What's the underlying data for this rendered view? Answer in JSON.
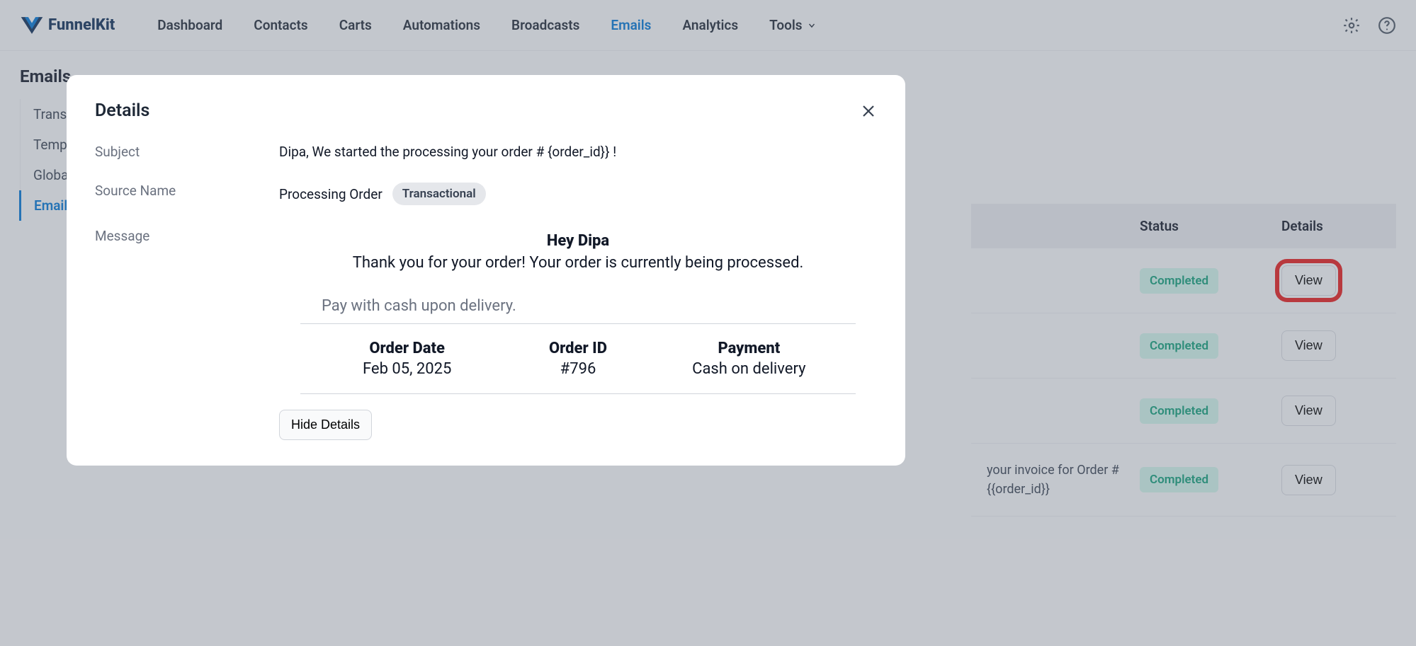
{
  "logo_text": "FunnelKit",
  "nav": {
    "items": [
      {
        "label": "Dashboard",
        "active": false
      },
      {
        "label": "Contacts",
        "active": false
      },
      {
        "label": "Carts",
        "active": false
      },
      {
        "label": "Automations",
        "active": false
      },
      {
        "label": "Broadcasts",
        "active": false
      },
      {
        "label": "Emails",
        "active": true
      },
      {
        "label": "Analytics",
        "active": false
      },
      {
        "label": "Tools",
        "active": false,
        "caret": true
      }
    ]
  },
  "page_title": "Emails",
  "sidebar": {
    "items": [
      {
        "label": "Transa",
        "active": false
      },
      {
        "label": "Templa",
        "active": false
      },
      {
        "label": "Global",
        "active": false
      },
      {
        "label": "Email H",
        "active": true
      }
    ]
  },
  "table": {
    "columns": {
      "status": "Status",
      "details": "Details"
    },
    "rows": [
      {
        "status": "Completed",
        "view": "View",
        "highlight": true
      },
      {
        "status": "Completed",
        "view": "View"
      },
      {
        "status": "Completed",
        "view": "View"
      },
      {
        "status": "Completed",
        "view": "View",
        "text_prefix": "your invoice for Order #\n{{order_id}}"
      }
    ]
  },
  "modal": {
    "title": "Details",
    "fields": {
      "subject_label": "Subject",
      "subject_value": "Dipa, We started the processing your order # {order_id}} !",
      "source_label": "Source Name",
      "source_value": "Processing Order",
      "source_tag": "Transactional",
      "message_label": "Message"
    },
    "message": {
      "greeting": "Hey Dipa",
      "subline": "Thank you for your order! Your order is currently being processed.",
      "pay_note": "Pay with cash upon delivery.",
      "meta": {
        "date_label": "Order Date",
        "date_value": "Feb 05, 2025",
        "id_label": "Order ID",
        "id_value": "#796",
        "pay_label": "Payment",
        "pay_value": "Cash on delivery"
      },
      "hide_button": "Hide Details"
    }
  }
}
